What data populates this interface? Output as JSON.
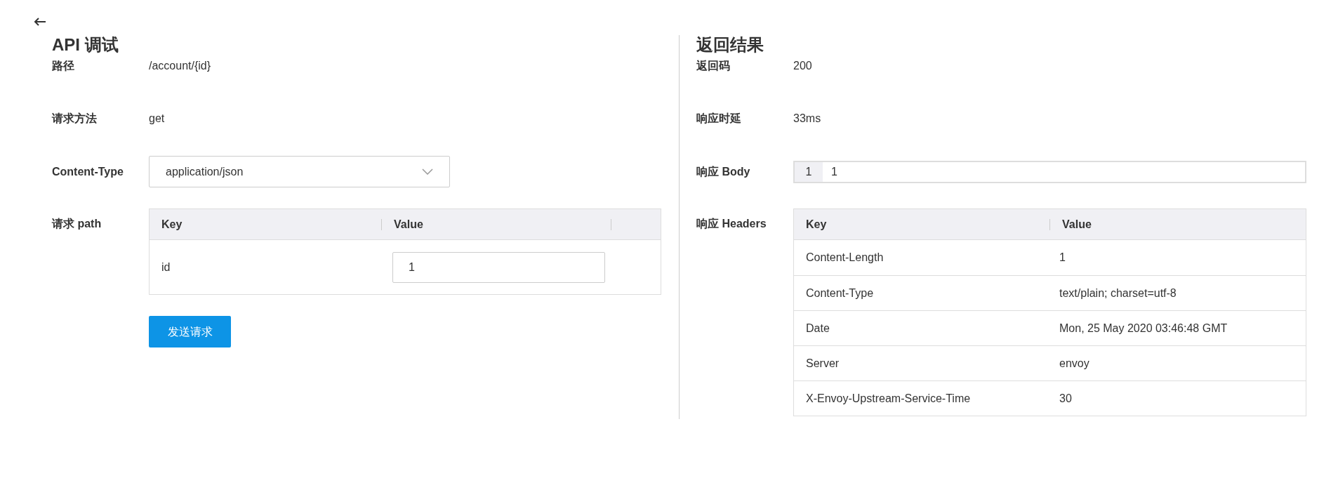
{
  "request": {
    "title": "API 调试",
    "path": {
      "label": "路径",
      "value": "/account/{id}"
    },
    "method": {
      "label": "请求方法",
      "value": "get"
    },
    "content_type": {
      "label": "Content-Type",
      "value": "application/json"
    },
    "params": {
      "label": "请求 path",
      "columns": [
        "Key",
        "Value"
      ],
      "rows": [
        {
          "key": "id",
          "value": "1"
        }
      ]
    },
    "send_button": "发送请求"
  },
  "response": {
    "title": "返回结果",
    "code": {
      "label": "返回码",
      "value": "200"
    },
    "latency": {
      "label": "响应时延",
      "value": "33ms"
    },
    "body": {
      "label": "响应 Body",
      "lines": [
        {
          "number": "1",
          "text": "1"
        }
      ]
    },
    "headers": {
      "label": "响应 Headers",
      "columns": [
        "Key",
        "Value"
      ],
      "rows": [
        {
          "key": "Content-Length",
          "value": "1"
        },
        {
          "key": "Content-Type",
          "value": "text/plain; charset=utf-8"
        },
        {
          "key": "Date",
          "value": "Mon, 25 May 2020 03:46:48 GMT"
        },
        {
          "key": "Server",
          "value": "envoy"
        },
        {
          "key": "X-Envoy-Upstream-Service-Time",
          "value": "30"
        }
      ]
    }
  }
}
